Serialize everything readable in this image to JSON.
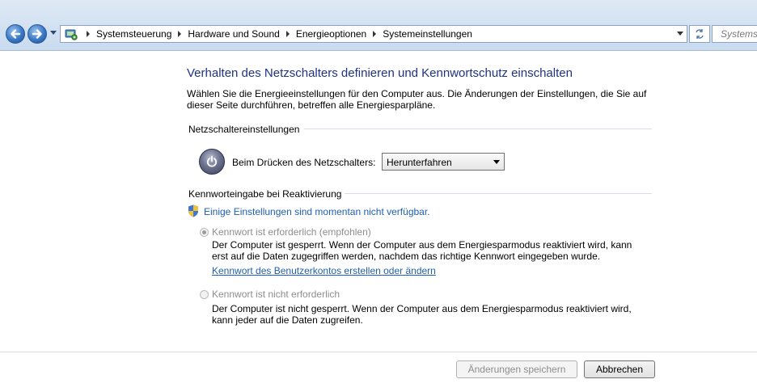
{
  "addressbar": {
    "breadcrumbs": [
      "Systemsteuerung",
      "Hardware und Sound",
      "Energieoptionen",
      "Systemeinstellungen"
    ],
    "search_placeholder": "Systemst"
  },
  "main": {
    "title": "Verhalten des Netzschalters definieren und Kennwortschutz einschalten",
    "intro": "Wählen Sie die Energieeinstellungen für den Computer aus. Die Änderungen der Einstellungen, die Sie auf dieser Seite durchführen, betreffen alle Energiesparpläne.",
    "power_section": {
      "heading": "Netzschaltereinstellungen",
      "label": "Beim Drücken des Netzschalters:",
      "selected": "Herunterfahren"
    },
    "password_section": {
      "heading": "Kennworteingabe bei Reaktivierung",
      "unavailable_link": "Einige Einstellungen sind momentan nicht verfügbar.",
      "option_required": {
        "label": "Kennwort ist erforderlich (empfohlen)",
        "selected": true,
        "description": "Der Computer ist gesperrt. Wenn der Computer aus dem Energiesparmodus reaktiviert wird, kann erst auf die Daten zugegriffen werden, nachdem das richtige Kennwort eingegeben wurde.",
        "link": "Kennwort des Benutzerkontos erstellen oder ändern"
      },
      "option_not_required": {
        "label": "Kennwort ist nicht erforderlich",
        "selected": false,
        "description": "Der Computer ist nicht gesperrt. Wenn der Computer aus dem Energiesparmodus reaktiviert wird, kann jeder auf die Daten zugreifen."
      }
    }
  },
  "footer": {
    "save_label": "Änderungen speichern",
    "cancel_label": "Abbrechen"
  }
}
